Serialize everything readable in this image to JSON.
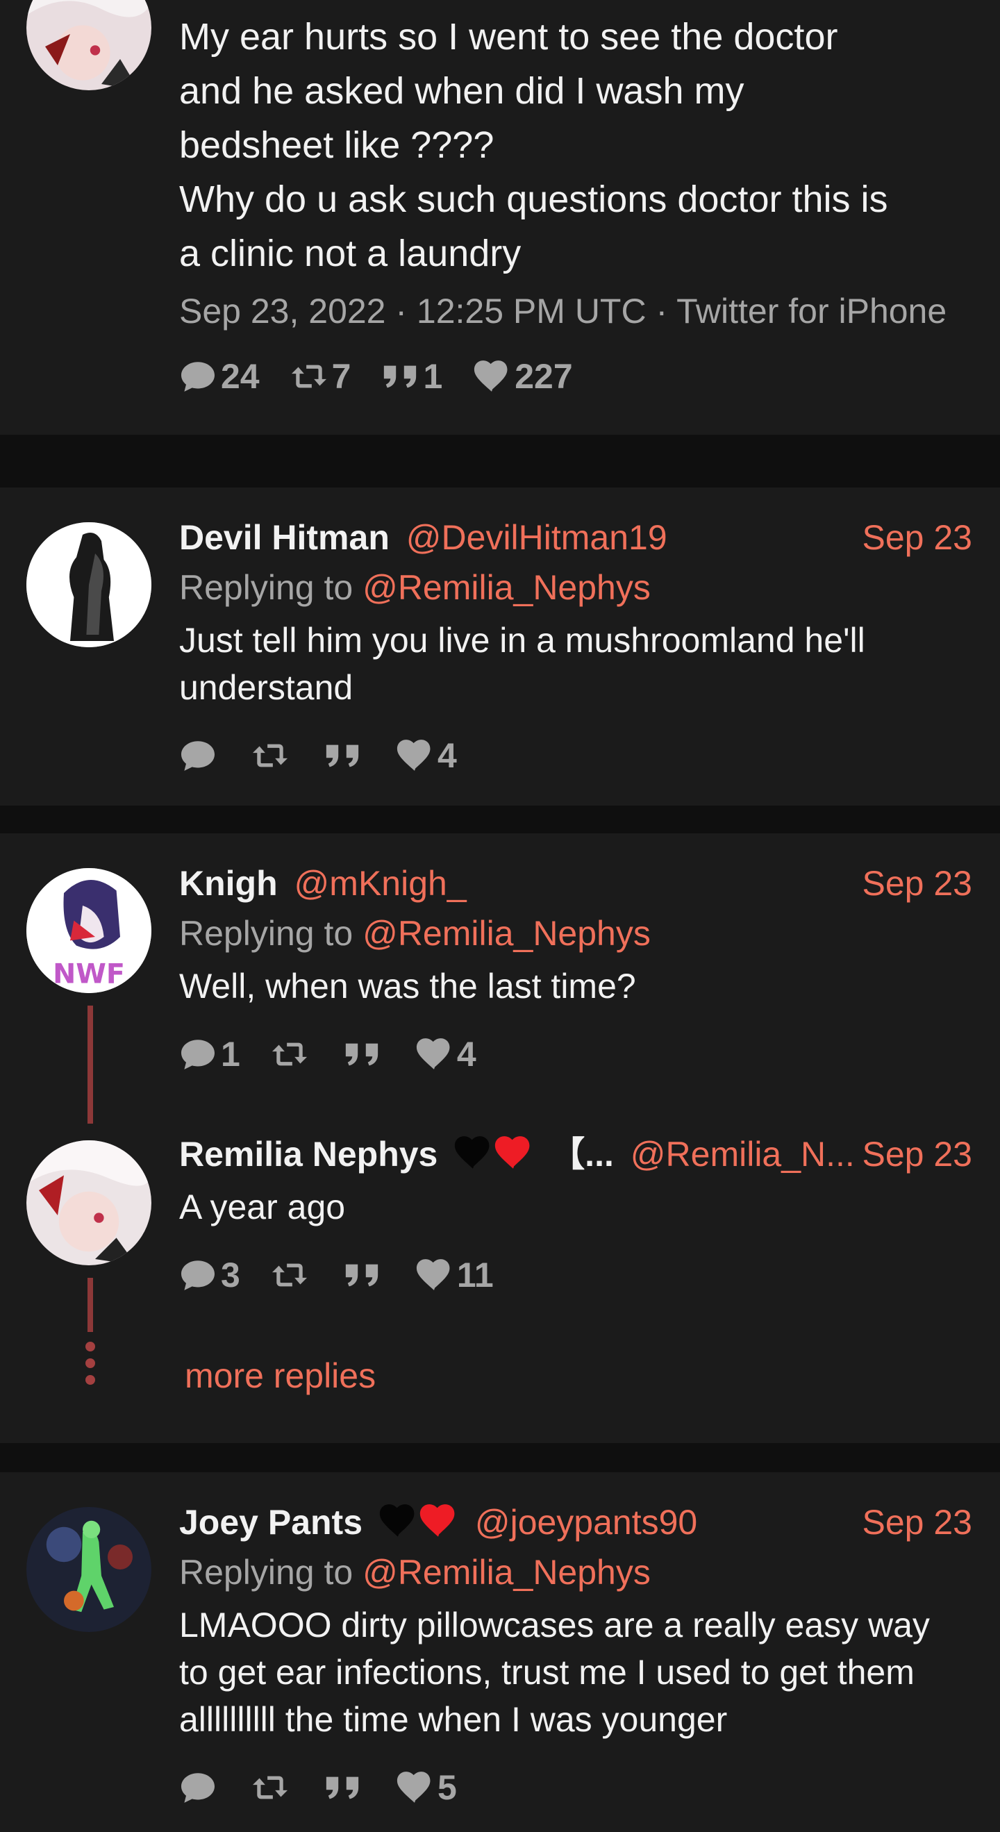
{
  "main_tweet": {
    "text": "My ear hurts so I went to see the doctor\nand he asked when did I wash my\nbedsheet like ????\nWhy do u ask such questions doctor this is\na clinic not a laundry",
    "timestamp": "Sep 23, 2022 · 12:25 PM UTC · Twitter for iPhone",
    "stats": {
      "replies": "24",
      "retweets": "7",
      "quotes": "1",
      "likes": "227"
    }
  },
  "replies": [
    {
      "name": "Devil Hitman",
      "handle": "@DevilHitman19",
      "date": "Sep 23",
      "replying_prefix": "Replying to",
      "replying_to": "@Remilia_Nephys",
      "text": "Just tell him you live in a mushroomland he'll\nunderstand",
      "stats": {
        "replies": "",
        "retweets": "",
        "quotes": "",
        "likes": "4"
      }
    },
    {
      "name": "Knigh",
      "handle": "@mKnigh_",
      "date": "Sep 23",
      "replying_prefix": "Replying to",
      "replying_to": "@Remilia_Nephys",
      "text": "Well, when was the last time?",
      "stats": {
        "replies": "1",
        "retweets": "",
        "quotes": "",
        "likes": "4"
      }
    },
    {
      "name": "Remilia Nephys",
      "name_suffix": "【...",
      "handle": "@Remilia_N...",
      "date": "Sep 23",
      "text": "A year ago",
      "stats": {
        "replies": "3",
        "retweets": "",
        "quotes": "",
        "likes": "11"
      }
    },
    {
      "name": "Joey Pants",
      "handle": "@joeypants90",
      "date": "Sep 23",
      "replying_prefix": "Replying to",
      "replying_to": "@Remilia_Nephys",
      "text": "LMAOOO dirty pillowcases are a really easy way\nto get ear infections, trust me I used to get them\nallllllllll the time when I was younger",
      "stats": {
        "replies": "",
        "retweets": "",
        "quotes": "",
        "likes": "5"
      }
    }
  ],
  "more_replies": "more replies",
  "colors": {
    "accent": "#f0705a",
    "background": "#0f0f0f",
    "card": "#1b1b1b",
    "muted": "#a6a6a6",
    "thread": "#8d3838"
  }
}
